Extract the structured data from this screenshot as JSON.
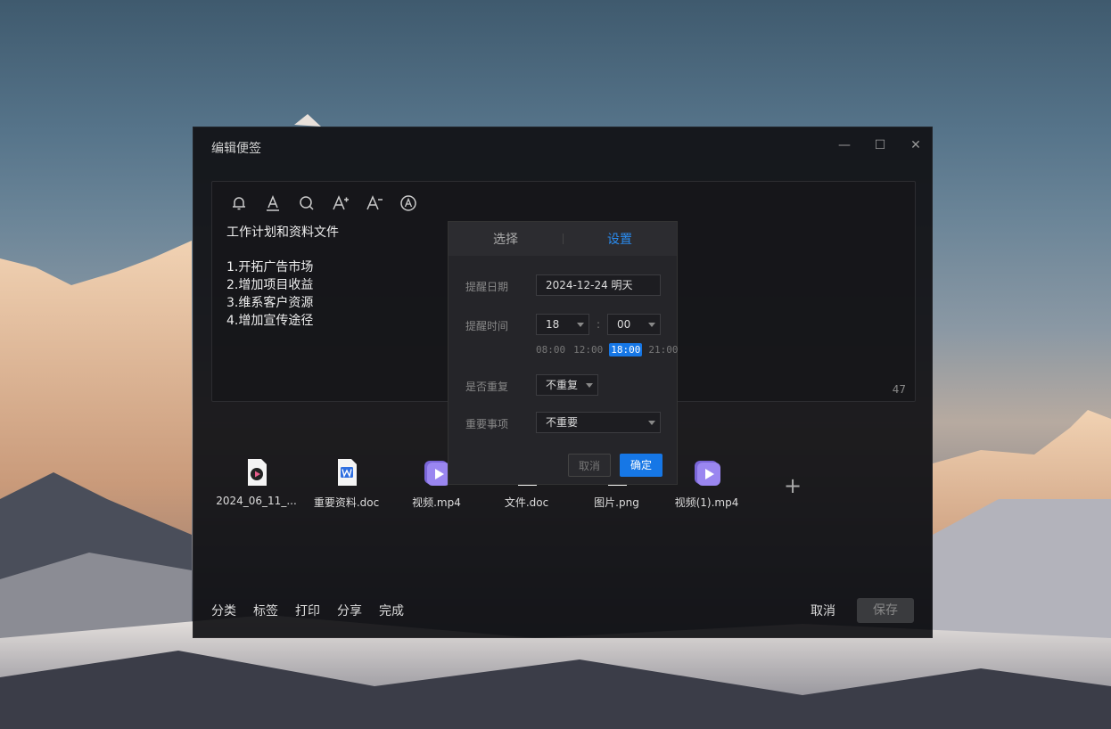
{
  "window": {
    "title": "编辑便签",
    "minimize_icon": "—",
    "maximize_icon": "☐",
    "close_icon": "✕"
  },
  "toolbar": [
    "bell-icon",
    "text-color-icon",
    "search-icon",
    "font-increase-icon",
    "font-decrease-icon",
    "auto-format-icon"
  ],
  "note": {
    "title": "工作计划和资料文件",
    "lines": [
      "1.开拓广告市场",
      "2.增加项目收益",
      "3.维系客户资源",
      "4.增加宣传途径"
    ],
    "char_count": "47"
  },
  "files": [
    {
      "name": "2024_06_11_...",
      "type": "video"
    },
    {
      "name": "重要资料.doc",
      "type": "word"
    },
    {
      "name": "视频.mp4",
      "type": "mp4"
    },
    {
      "name": "文件.doc",
      "type": "doc"
    },
    {
      "name": "图片.png",
      "type": "image"
    },
    {
      "name": "视频(1).mp4",
      "type": "mp4"
    }
  ],
  "add_icon": "+",
  "bottom": {
    "items": [
      "分类",
      "标签",
      "打印",
      "分享",
      "完成"
    ],
    "cancel": "取消",
    "save": "保存"
  },
  "popup": {
    "tabs": [
      "选择",
      "设置"
    ],
    "active_tab": 1,
    "date_label": "提醒日期",
    "date_value": "2024-12-24 明天",
    "time_label": "提醒时间",
    "hour": "18",
    "colon": ":",
    "minute": "00",
    "quick_times": [
      "08:00",
      "12:00",
      "18:00",
      "21:00"
    ],
    "quick_selected": 2,
    "repeat_label": "是否重复",
    "repeat_value": "不重复",
    "important_label": "重要事项",
    "important_value": "不重要",
    "cancel": "取消",
    "confirm": "确定"
  },
  "colors": {
    "accent": "#1677e6",
    "panel": "#252529"
  }
}
